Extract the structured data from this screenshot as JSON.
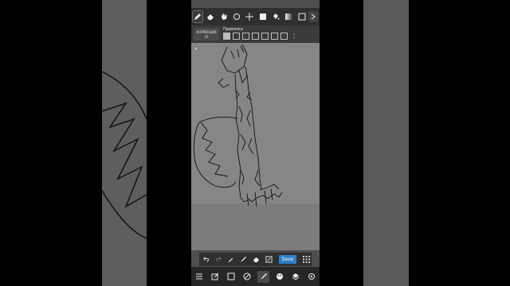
{
  "toolbar": {
    "tools": [
      "pen-icon",
      "eraser-icon",
      "hand-icon",
      "lasso-icon",
      "move-icon",
      "fill-rect-icon",
      "bucket-icon",
      "gradient-icon",
      "more-tools-icon"
    ],
    "active": "pen-icon"
  },
  "subbar": {
    "correction_label": "КОРРЕКЦИЯ",
    "correction_value": "15",
    "snap_label": "Привязка"
  },
  "actions": {
    "save_label": "Save"
  },
  "colors": {
    "toolbar_bg": "#2f2f2f",
    "canvas_bg": "#868686",
    "save_button": "#2f80c7"
  }
}
